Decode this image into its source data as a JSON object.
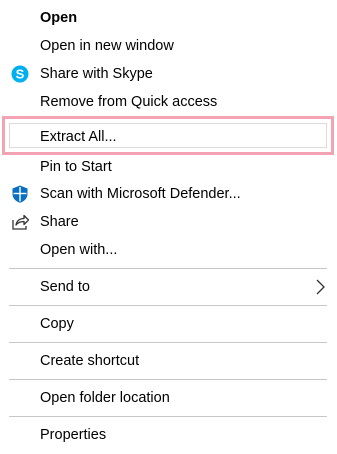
{
  "menu": {
    "items": [
      {
        "label": "Open"
      },
      {
        "label": "Open in new window"
      },
      {
        "label": "Share with Skype",
        "icon": "skype-icon"
      },
      {
        "label": "Remove from Quick access"
      },
      {
        "label": "Extract All...",
        "highlighted": true
      },
      {
        "label": "Pin to Start"
      },
      {
        "label": "Scan with Microsoft Defender...",
        "icon": "defender-shield-icon"
      },
      {
        "label": "Share",
        "icon": "share-icon"
      },
      {
        "label": "Open with..."
      },
      {
        "label": "Send to",
        "submenu": true
      },
      {
        "label": "Copy"
      },
      {
        "label": "Create shortcut"
      },
      {
        "label": "Open folder location"
      },
      {
        "label": "Properties"
      }
    ]
  },
  "colors": {
    "highlight_border": "#f4a3b5",
    "skype_blue": "#00aff0",
    "defender_blue": "#0a6fc2",
    "separator": "#c7c7c7"
  }
}
